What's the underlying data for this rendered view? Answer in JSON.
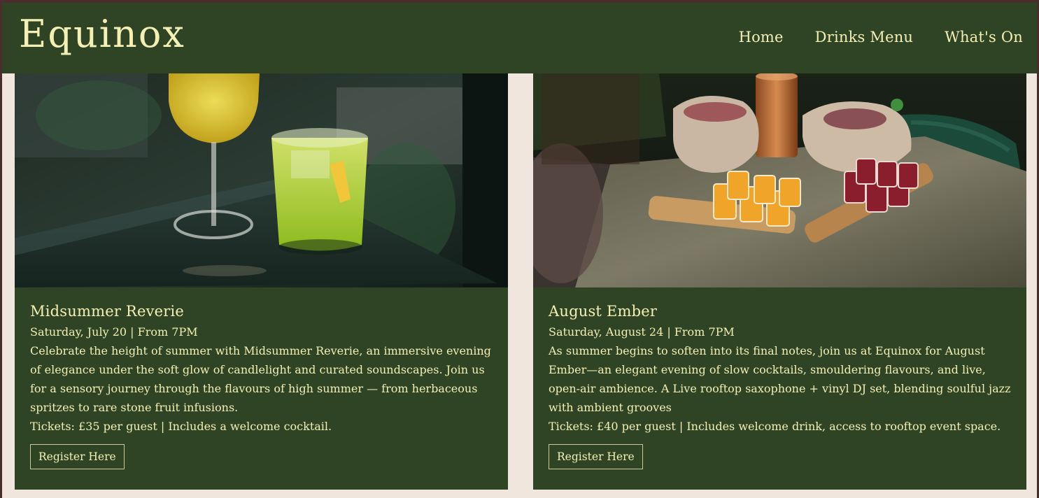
{
  "brand": {
    "name": "Equinox"
  },
  "nav": {
    "items": [
      {
        "label": "Home"
      },
      {
        "label": "Drinks Menu"
      },
      {
        "label": "What's On"
      }
    ]
  },
  "events": [
    {
      "title": "Midsummer Reverie",
      "date": "Saturday, July 20 | From 7PM",
      "description": "Celebrate the height of summer with Midsummer Reverie, an immersive evening of elegance under the soft glow of candlelight and curated soundscapes. Join us for a sensory journey through the flavours of high summer — from herbaceous spritzes to rare stone fruit infusions.",
      "tickets": "Tickets: £35 per guest | Includes a welcome cocktail.",
      "button_label": "Register Here"
    },
    {
      "title": "August Ember",
      "date": "Saturday, August 24 | From 7PM",
      "description": "As summer begins to soften into its final notes, join us at Equinox for August Ember—an elegant evening of slow cocktails, smouldering flavours, and live, open-air ambience. A Live rooftop saxophone + vinyl DJ set, blending soulful jazz with ambient grooves",
      "tickets": "Tickets: £40 per guest | Includes welcome drink, access to rooftop event space.",
      "button_label": "Register Here"
    }
  ],
  "colors": {
    "header_bg": "#2e4424",
    "card_bg": "#2e4424",
    "text_accent": "#f4efb5",
    "page_bg": "#f1e6dd"
  }
}
